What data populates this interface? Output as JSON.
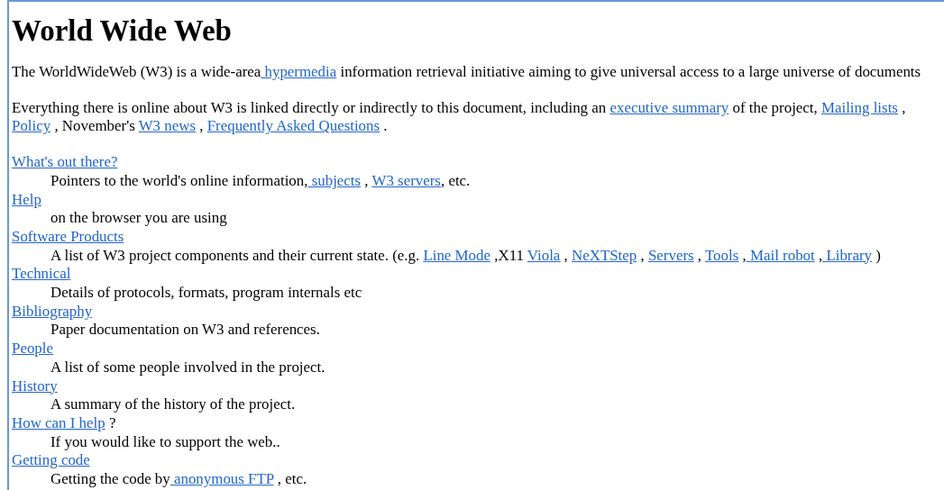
{
  "title": "World Wide Web",
  "paragraphs": [
    [
      {
        "kind": "text",
        "text": "The WorldWideWeb (W3) is a wide-area"
      },
      {
        "kind": "link",
        "text": " hypermedia"
      },
      {
        "kind": "text",
        "text": " information retrieval initiative aiming to give universal access to a large universe of documents"
      }
    ],
    [
      {
        "kind": "text",
        "text": "Everything there is online about W3 is linked directly or indirectly to this document, including an "
      },
      {
        "kind": "link",
        "text": "executive summary"
      },
      {
        "kind": "text",
        "text": " of the project, "
      },
      {
        "kind": "link",
        "text": "Mailing lists"
      },
      {
        "kind": "text",
        "text": " , "
      },
      {
        "kind": "link",
        "text": "Policy"
      },
      {
        "kind": "text",
        "text": " , November's "
      },
      {
        "kind": "link",
        "text": "W3 news"
      },
      {
        "kind": "text",
        "text": " , "
      },
      {
        "kind": "link",
        "text": "Frequently Asked Questions"
      },
      {
        "kind": "text",
        "text": " ."
      }
    ]
  ],
  "entries": [
    {
      "term": [
        {
          "kind": "link",
          "text": "What's out there?"
        }
      ],
      "description": [
        {
          "kind": "text",
          "text": "Pointers to the world's online information,"
        },
        {
          "kind": "link",
          "text": " subjects"
        },
        {
          "kind": "text",
          "text": " , "
        },
        {
          "kind": "link",
          "text": "W3 servers"
        },
        {
          "kind": "text",
          "text": ", etc."
        }
      ]
    },
    {
      "term": [
        {
          "kind": "link",
          "text": "Help"
        }
      ],
      "description": [
        {
          "kind": "text",
          "text": "on the browser you are using"
        }
      ]
    },
    {
      "term": [
        {
          "kind": "link",
          "text": "Software Products"
        }
      ],
      "description": [
        {
          "kind": "text",
          "text": "A list of W3 project components and their current state. (e.g. "
        },
        {
          "kind": "link",
          "text": "Line Mode"
        },
        {
          "kind": "text",
          "text": " ,X11 "
        },
        {
          "kind": "link",
          "text": "Viola"
        },
        {
          "kind": "text",
          "text": " , "
        },
        {
          "kind": "link",
          "text": "NeXTStep"
        },
        {
          "kind": "text",
          "text": " , "
        },
        {
          "kind": "link",
          "text": "Servers"
        },
        {
          "kind": "text",
          "text": " , "
        },
        {
          "kind": "link",
          "text": "Tools"
        },
        {
          "kind": "text",
          "text": " ,"
        },
        {
          "kind": "link",
          "text": " Mail robot"
        },
        {
          "kind": "text",
          "text": " ,"
        },
        {
          "kind": "link",
          "text": " Library"
        },
        {
          "kind": "text",
          "text": " )"
        }
      ]
    },
    {
      "term": [
        {
          "kind": "link",
          "text": "Technical"
        }
      ],
      "description": [
        {
          "kind": "text",
          "text": "Details of protocols, formats, program internals etc"
        }
      ]
    },
    {
      "term": [
        {
          "kind": "link",
          "text": "Bibliography"
        }
      ],
      "description": [
        {
          "kind": "text",
          "text": "Paper documentation on W3 and references."
        }
      ]
    },
    {
      "term": [
        {
          "kind": "link",
          "text": "People"
        }
      ],
      "description": [
        {
          "kind": "text",
          "text": "A list of some people involved in the project."
        }
      ]
    },
    {
      "term": [
        {
          "kind": "link",
          "text": "History"
        }
      ],
      "description": [
        {
          "kind": "text",
          "text": "A summary of the history of the project."
        }
      ]
    },
    {
      "term": [
        {
          "kind": "link",
          "text": "How can I help"
        },
        {
          "kind": "text",
          "text": " ?"
        }
      ],
      "description": [
        {
          "kind": "text",
          "text": "If you would like to support the web.."
        }
      ]
    },
    {
      "term": [
        {
          "kind": "link",
          "text": "Getting code"
        }
      ],
      "description": [
        {
          "kind": "text",
          "text": "Getting the code by"
        },
        {
          "kind": "link",
          "text": " anonymous FTP"
        },
        {
          "kind": "text",
          "text": " , etc."
        }
      ]
    }
  ]
}
